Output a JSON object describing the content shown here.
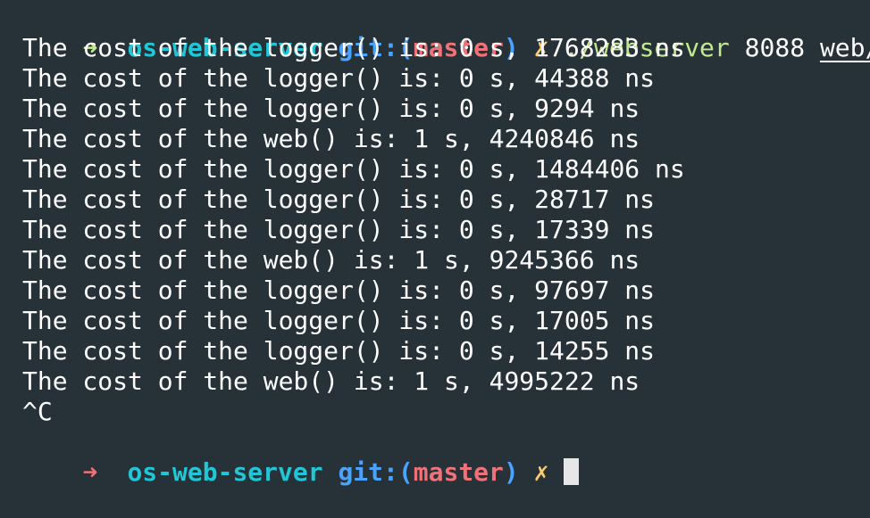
{
  "prompt1": {
    "arrow": "➜",
    "dir": "os-web-server",
    "git_label": "git:",
    "paren_open": "(",
    "branch": "master",
    "paren_close": ")",
    "dirty": "✗",
    "command": "./webserver",
    "port": "8088",
    "path": "web/"
  },
  "output": [
    "The cost of the logger() is: 0 s, 1768283 ns",
    "The cost of the logger() is: 0 s, 44388 ns",
    "The cost of the logger() is: 0 s, 9294 ns",
    "The cost of the web() is: 1 s, 4240846 ns",
    "The cost of the logger() is: 0 s, 1484406 ns",
    "The cost of the logger() is: 0 s, 28717 ns",
    "The cost of the logger() is: 0 s, 17339 ns",
    "The cost of the web() is: 1 s, 9245366 ns",
    "The cost of the logger() is: 0 s, 97697 ns",
    "The cost of the logger() is: 0 s, 17005 ns",
    "The cost of the logger() is: 0 s, 14255 ns",
    "The cost of the web() is: 1 s, 4995222 ns",
    "^C"
  ],
  "prompt2": {
    "arrow": "➜",
    "dir": "os-web-server",
    "git_label": "git:",
    "paren_open": "(",
    "branch": "master",
    "paren_close": ")",
    "dirty": "✗"
  },
  "colors": {
    "background": "#263238",
    "arrow_success": "#c3e88d",
    "arrow_error": "#f07178",
    "directory": "#21c7d6",
    "git_label": "#4aa3ff",
    "branch": "#f07178",
    "dirty_marker": "#ffcb6b",
    "command": "#c3e88d",
    "text": "#ffffff"
  }
}
